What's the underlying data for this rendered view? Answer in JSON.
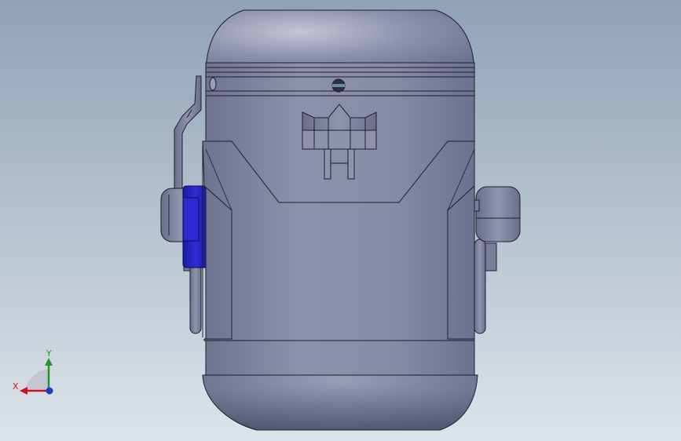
{
  "viewport": {
    "background_top": "#8fa2b6",
    "background_bottom": "#dde3ea",
    "model_color": "#868ba6",
    "model_highlight": "#b9bccf",
    "model_shadow": "#5d6079",
    "edge_color": "#1e1f2b",
    "selected_part_color": "#2121c8"
  },
  "triad": {
    "x_label": "X",
    "y_label": "Y",
    "x_color": "#c8141e",
    "y_color": "#1e9a2a",
    "z_color": "#1e3cc8"
  }
}
